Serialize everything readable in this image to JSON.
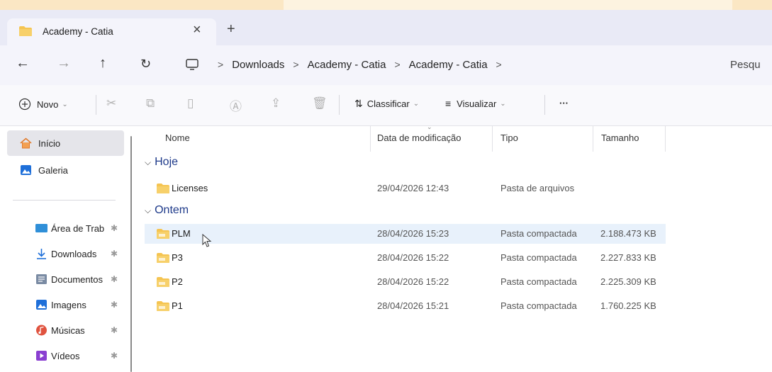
{
  "tab": {
    "title": "Academy - Catia",
    "close": "×",
    "new": "+"
  },
  "nav": {
    "back": "←",
    "forward": "→",
    "up": "↑",
    "refresh": "↻"
  },
  "breadcrumbs": [
    "Downloads",
    "Academy - Catia",
    "Academy - Catia"
  ],
  "breadcrumb_sep": ">",
  "search": {
    "placeholder": "Pesqu"
  },
  "toolbar": {
    "new_label": "Novo",
    "sort_label": "Classificar",
    "view_label": "Visualizar",
    "more_label": "···"
  },
  "sidebar": {
    "items": [
      {
        "label": "Início",
        "icon": "home-icon",
        "pinned": false
      },
      {
        "label": "Galeria",
        "icon": "gallery-icon",
        "pinned": false
      },
      {
        "label": "Área de Trab",
        "icon": "desktop-icon",
        "pinned": true
      },
      {
        "label": "Downloads",
        "icon": "download-icon",
        "pinned": true
      },
      {
        "label": "Documentos",
        "icon": "documents-icon",
        "pinned": true
      },
      {
        "label": "Imagens",
        "icon": "images-icon",
        "pinned": true
      },
      {
        "label": "Músicas",
        "icon": "music-icon",
        "pinned": true
      },
      {
        "label": "Vídeos",
        "icon": "videos-icon",
        "pinned": true
      }
    ],
    "pin": "✱"
  },
  "columns": {
    "name": "Nome",
    "date": "Data de modificação",
    "type": "Tipo",
    "size": "Tamanho"
  },
  "groups": [
    {
      "title": "Hoje",
      "files": [
        {
          "name": "Licenses",
          "date": "29/04/2026 12:43",
          "type": "Pasta de arquivos",
          "size": "",
          "kind": "folder"
        }
      ]
    },
    {
      "title": "Ontem",
      "files": [
        {
          "name": "PLM",
          "date": "28/04/2026 15:23",
          "type": "Pasta compactada",
          "size": "2.188.473 KB",
          "kind": "zip"
        },
        {
          "name": "P3",
          "date": "28/04/2026 15:22",
          "type": "Pasta compactada",
          "size": "2.227.833 KB",
          "kind": "zip"
        },
        {
          "name": "P2",
          "date": "28/04/2026 15:22",
          "type": "Pasta compactada",
          "size": "2.225.309 KB",
          "kind": "zip"
        },
        {
          "name": "P1",
          "date": "28/04/2026 15:21",
          "type": "Pasta compactada",
          "size": "1.760.225 KB",
          "kind": "zip"
        }
      ]
    }
  ],
  "colors": {
    "accent": "#1e3a8a",
    "folder": "#f5c451",
    "hover_row": "#e8f1fb",
    "tabbar": "#e9eaf6"
  }
}
